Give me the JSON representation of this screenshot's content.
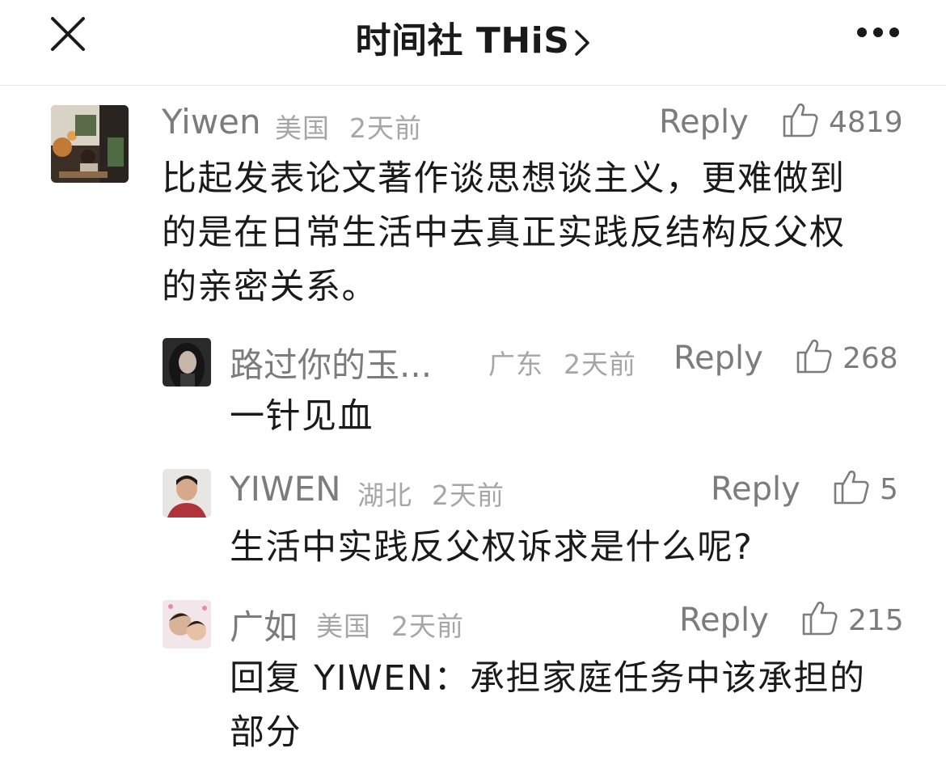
{
  "header": {
    "title": "时间社 THiS",
    "close_icon": "close-icon",
    "more_icon": "more-icon"
  },
  "comments": [
    {
      "name": "Yiwen",
      "location": "美国",
      "time": "2天前",
      "reply_label": "Reply",
      "likes": "4819",
      "text": "比起发表论文著作谈思想谈主义，更难做到的是在日常生活中去真正实践反结构反父权的亲密关系。"
    },
    {
      "name": "路过你的玉...",
      "location": "广东",
      "time": "2天前",
      "reply_label": "Reply",
      "likes": "268",
      "text": "一针见血"
    },
    {
      "name": "YIWEN",
      "location": "湖北",
      "time": "2天前",
      "reply_label": "Reply",
      "likes": "5",
      "text": "生活中实践反父权诉求是什么呢?"
    },
    {
      "name": "广如",
      "location": "美国",
      "time": "2天前",
      "reply_label": "Reply",
      "likes": "215",
      "text": "回复 YIWEN：承担家庭任务中该承担的部分"
    }
  ],
  "colors": {
    "name": "#7c7c7c",
    "meta": "#a6a6a6",
    "text": "#1a1a1a",
    "divider": "#e6e6e6"
  }
}
